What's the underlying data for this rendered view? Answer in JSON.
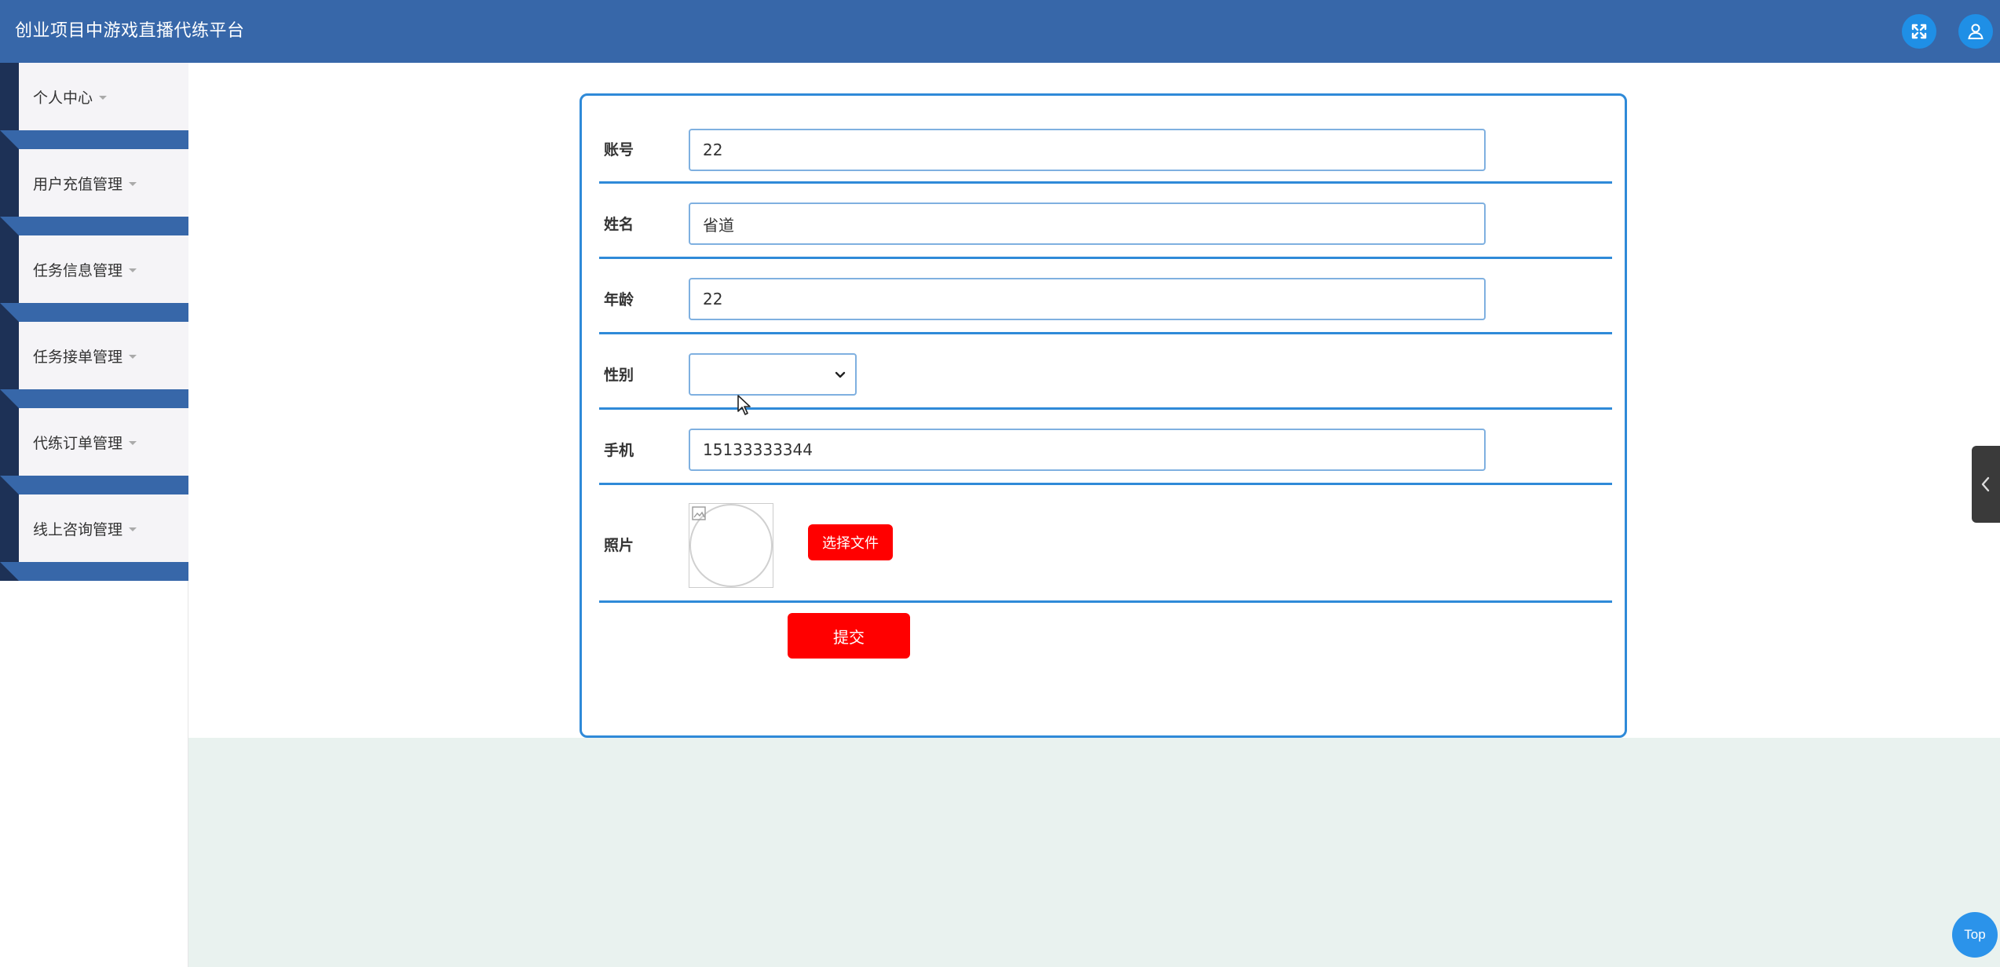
{
  "header": {
    "title": "创业项目中游戏直播代练平台",
    "fullscreen_icon": "fullscreen-icon",
    "user_icon": "user-icon"
  },
  "sidebar": {
    "items": [
      {
        "label": "个人中心"
      },
      {
        "label": "用户充值管理"
      },
      {
        "label": "任务信息管理"
      },
      {
        "label": "任务接单管理"
      },
      {
        "label": "代练订单管理"
      },
      {
        "label": "线上咨询管理"
      }
    ]
  },
  "form": {
    "account": {
      "label": "账号",
      "value": "22"
    },
    "name": {
      "label": "姓名",
      "value": "省道"
    },
    "age": {
      "label": "年龄",
      "value": "22"
    },
    "gender": {
      "label": "性别",
      "value": ""
    },
    "phone": {
      "label": "手机",
      "value": "15133333344"
    },
    "photo": {
      "label": "照片",
      "choose_label": "选择文件"
    },
    "submit_label": "提交"
  },
  "floating": {
    "top_label": "Top"
  },
  "colors": {
    "header_bg": "#3767a9",
    "sidebar_dark": "#1d3156",
    "accent_blue": "#2f8ad8",
    "danger_red": "#ff0000",
    "content_bottom": "#e9f2ef"
  }
}
